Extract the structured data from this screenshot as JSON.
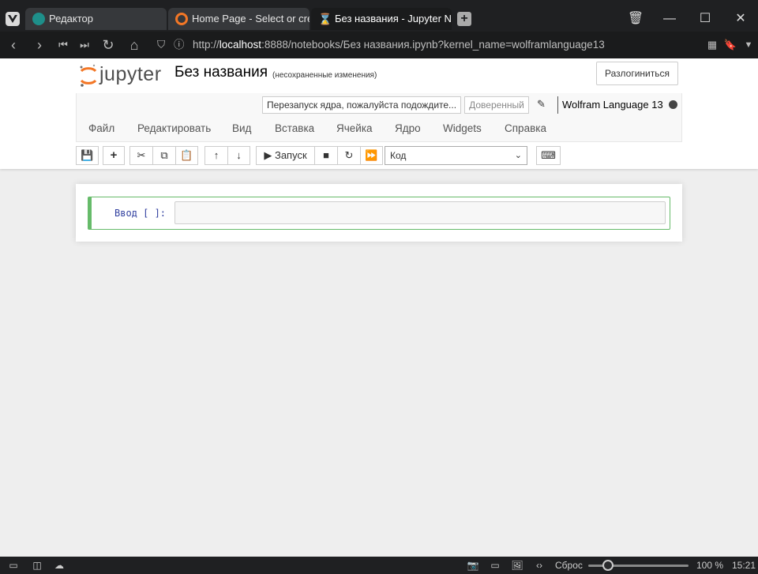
{
  "browser": {
    "tabs": [
      {
        "label": "Редактор",
        "active": false
      },
      {
        "label": "Home Page - Select or crea",
        "active": false
      },
      {
        "label": "Без названия - Jupyter Not",
        "active": true
      }
    ],
    "url_prefix": "http://",
    "url_host": "localhost",
    "url_rest": ":8888/notebooks/Без названия.ipynb?kernel_name=wolframlanguage13"
  },
  "jupyter": {
    "logo_text": "jupyter",
    "notebook_title": "Без названия",
    "autosave_status": "(несохраненные изменения)",
    "logout_label": "Разлогиниться",
    "kernel_message": "Перезапуск ядра, пожалуйста подождите...",
    "trusted_label": "Доверенный",
    "kernel_name": "Wolfram Language 13",
    "menu": [
      "Файл",
      "Редактировать",
      "Вид",
      "Вставка",
      "Ячейка",
      "Ядро",
      "Widgets",
      "Справка"
    ],
    "toolbar": {
      "run_label": "▶ Запуск",
      "cell_type": "Код"
    },
    "cell": {
      "prompt": "Ввод [ ]:"
    }
  },
  "statusbar": {
    "reset_label": "Сброс",
    "zoom": "100 %",
    "time": "15:21"
  },
  "colors": {
    "cell_border": "#66bb6a",
    "prompt": "#303f9f",
    "jupyter_orange": "#f37726"
  }
}
